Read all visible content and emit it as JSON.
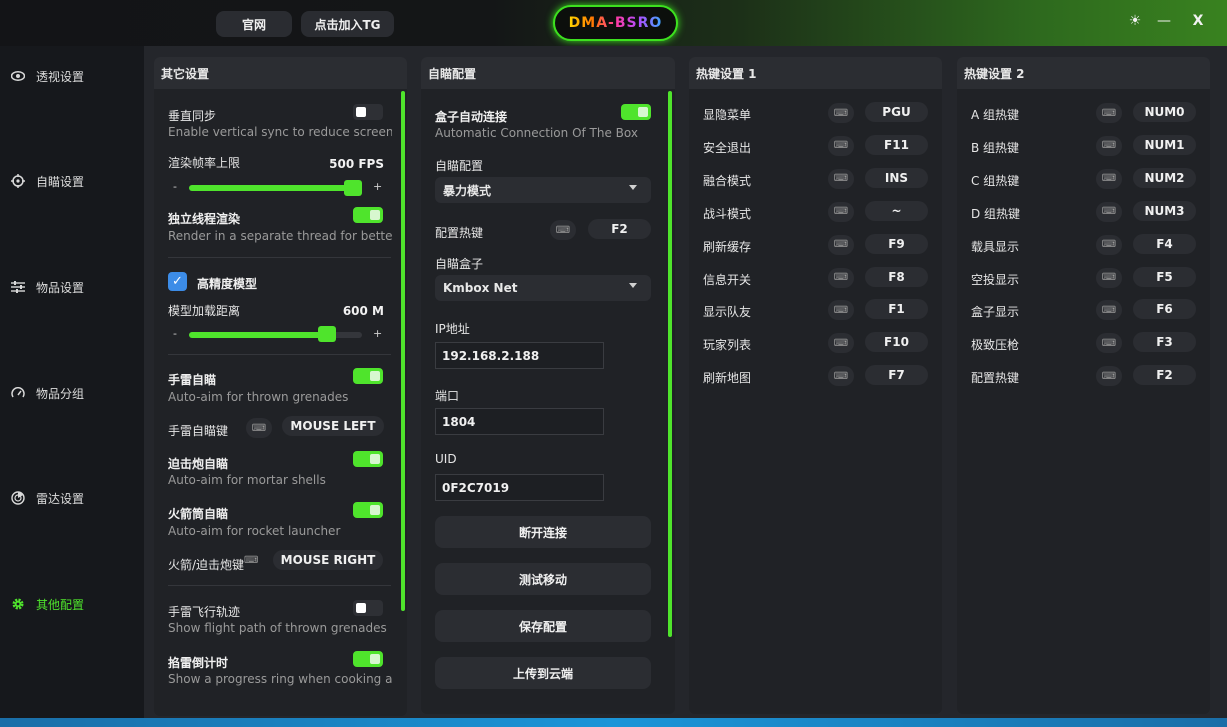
{
  "titlebar": {
    "btn_official": "官网",
    "btn_tg": "点击加入TG",
    "logo_text": "DMA-BSRO",
    "theme_icon": "sun-icon",
    "minimize": "—",
    "close": "X"
  },
  "sidebar": {
    "items": [
      {
        "label": "透视设置",
        "icon": "eye-icon"
      },
      {
        "label": "自瞄设置",
        "icon": "crosshair-icon"
      },
      {
        "label": "物品设置",
        "icon": "sliders-icon"
      },
      {
        "label": "物品分组",
        "icon": "gauge-icon"
      },
      {
        "label": "雷达设置",
        "icon": "radar-icon"
      },
      {
        "label": "其他配置",
        "icon": "gear-icon"
      }
    ],
    "active": "其他配置"
  },
  "other_settings": {
    "title": "其它设置",
    "vsync_label": "垂直同步",
    "vsync_desc": "Enable vertical sync to reduce screen tearing",
    "fps_label": "渲染帧率上限",
    "fps_value": "500 FPS",
    "fps_fraction": 0.95,
    "minus": "-",
    "plus": "+",
    "thread_label": "独立线程渲染",
    "thread_desc": "Render in a separate thread for better performance",
    "hq_label": "高精度模型",
    "hq_check": "✓",
    "load_label": "模型加载距离",
    "load_value": "600 M",
    "load_fraction": 0.8,
    "grenade_label": "手雷自瞄",
    "grenade_desc": "Auto-aim for thrown grenades",
    "grenade_key_label": "手雷自瞄键",
    "grenade_key": "MOUSE LEFT",
    "mortar_label": "迫击炮自瞄",
    "mortar_desc": "Auto-aim for mortar shells",
    "rocket_label": "火箭筒自瞄",
    "rocket_desc": "Auto-aim for rocket launcher",
    "rocket_key_label": "火箭/迫击炮键",
    "rocket_key": "MOUSE RIGHT",
    "flight_label": "手雷飞行轨迹",
    "flight_desc": "Show flight path of thrown grenades",
    "mine_label": "掐雷倒计时",
    "mine_desc": "Show a progress ring when cooking a grenade",
    "kbd_glyph": "⌨"
  },
  "aim_config": {
    "title": "自瞄配置",
    "auto_label": "盒子自动连接",
    "auto_desc": "Automatic Connection Of The Box",
    "aim_cfg_label": "自瞄配置",
    "aim_mode": "暴力模式",
    "hotkey_label": "配置热键",
    "hotkey": "F2",
    "box_label": "自瞄盒子",
    "box_value": "Kmbox Net",
    "ip_label": "IP地址",
    "ip_value": "192.168.2.188",
    "port_label": "端口",
    "port_value": "1804",
    "uid_label": "UID",
    "uid_value": "0F2C7019",
    "btn_disconnect": "断开连接",
    "btn_test": "测试移动",
    "btn_save": "保存配置",
    "btn_upload": "上传到云端"
  },
  "hotkeys1": {
    "title": "热键设置 1",
    "rows": [
      {
        "label": "显隐菜单",
        "key": "PGU"
      },
      {
        "label": "安全退出",
        "key": "F11"
      },
      {
        "label": "融合模式",
        "key": "INS"
      },
      {
        "label": "战斗模式",
        "key": "~"
      },
      {
        "label": "刷新缓存",
        "key": "F9"
      },
      {
        "label": "信息开关",
        "key": "F8"
      },
      {
        "label": "显示队友",
        "key": "F1"
      },
      {
        "label": "玩家列表",
        "key": "F10"
      },
      {
        "label": "刷新地图",
        "key": "F7"
      }
    ]
  },
  "hotkeys2": {
    "title": "热键设置 2",
    "rows": [
      {
        "label": "A 组热键",
        "key": "NUM0"
      },
      {
        "label": "B 组热键",
        "key": "NUM1"
      },
      {
        "label": "C 组热键",
        "key": "NUM2"
      },
      {
        "label": "D 组热键",
        "key": "NUM3"
      },
      {
        "label": "载具显示",
        "key": "F4"
      },
      {
        "label": "空投显示",
        "key": "F5"
      },
      {
        "label": "盒子显示",
        "key": "F6"
      },
      {
        "label": "极致压枪",
        "key": "F3"
      },
      {
        "label": "配置热键",
        "key": "F2"
      }
    ]
  }
}
